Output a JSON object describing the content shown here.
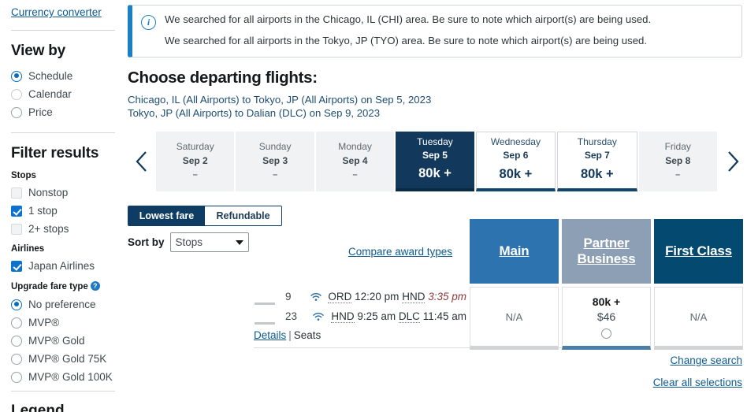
{
  "sidebar": {
    "currency_link": "Currency converter",
    "view_by": {
      "title": "View by",
      "options": [
        {
          "label": "Schedule",
          "selected": true
        },
        {
          "label": "Calendar",
          "selected": false
        },
        {
          "label": "Price",
          "selected": false
        }
      ]
    },
    "filter_results": {
      "title": "Filter results",
      "stops_title": "Stops",
      "stops": [
        {
          "label": "Nonstop",
          "checked": false
        },
        {
          "label": "1 stop",
          "checked": true
        },
        {
          "label": "2+ stops",
          "checked": false
        }
      ],
      "airlines_title": "Airlines",
      "airlines": [
        {
          "label": "Japan Airlines",
          "checked": true
        }
      ],
      "upgrade_title": "Upgrade fare type",
      "upgrade_help_icon": "question-mark-icon",
      "upgrade": [
        {
          "label": "No preference",
          "selected": true
        },
        {
          "label": "MVP®",
          "selected": false
        },
        {
          "label": "MVP® Gold",
          "selected": false
        },
        {
          "label": "MVP® Gold 75K",
          "selected": false
        },
        {
          "label": "MVP® Gold 100K",
          "selected": false
        }
      ]
    },
    "legend_title": "Legend"
  },
  "banner": {
    "icon": "info-icon",
    "messages": [
      "We searched for all airports in the Chicago, IL (CHI) area. Be sure to note which airport(s) are being used.",
      "We searched for all airports in the Tokyo, JP (TYO) area. Be sure to note which airport(s) are being used."
    ]
  },
  "header": {
    "title": "Choose departing flights:",
    "routes": [
      "Chicago, IL (All Airports) to Tokyo, JP (All Airports) on Sep 5, 2023",
      "Tokyo, JP (All Airports) to Dalian (DLC) on Sep 9, 2023"
    ]
  },
  "date_strip": {
    "prev_icon": "chevron-left-icon",
    "next_icon": "chevron-right-icon",
    "dates": [
      {
        "dow": "Saturday",
        "date": "Sep 2",
        "price": "–",
        "state": "unavailable"
      },
      {
        "dow": "Sunday",
        "date": "Sep 3",
        "price": "–",
        "state": "unavailable"
      },
      {
        "dow": "Monday",
        "date": "Sep 4",
        "price": "–",
        "state": "unavailable"
      },
      {
        "dow": "Tuesday",
        "date": "Sep 5",
        "price": "80k +",
        "state": "selected"
      },
      {
        "dow": "Wednesday",
        "date": "Sep 6",
        "price": "80k +",
        "state": "available"
      },
      {
        "dow": "Thursday",
        "date": "Sep 7",
        "price": "80k +",
        "state": "available"
      },
      {
        "dow": "Friday",
        "date": "Sep 8",
        "price": "–",
        "state": "unavailable"
      }
    ]
  },
  "controls": {
    "fare_toggle": [
      {
        "label": "Lowest fare",
        "active": true
      },
      {
        "label": "Refundable",
        "active": false
      }
    ],
    "sort_by_label": "Sort by",
    "sort_by_value": "Stops",
    "sort_by_icon": "chevron-down-icon",
    "compare_link": "Compare award types"
  },
  "fare_classes": [
    {
      "label": "Main",
      "color": "#2d73af"
    },
    {
      "label": "Partner Business",
      "color": "#8c9fb4"
    },
    {
      "label": "First Class",
      "color": "#044a70"
    }
  ],
  "itinerary": {
    "segments": [
      {
        "airline_logo": "japan-airlines-logo",
        "flight_number": "9",
        "wifi_icon": "wifi-icon",
        "origin": "ORD",
        "depart": "12:20 pm",
        "destination": "HND",
        "arrive": "3:35 pm",
        "arrive_next_day": true
      },
      {
        "airline_logo": "japan-airlines-logo",
        "flight_number": "23",
        "wifi_icon": "wifi-icon",
        "origin": "HND",
        "depart": "9:25 am",
        "destination": "DLC",
        "arrive": "11:45 am",
        "arrive_next_day": false
      }
    ],
    "details_link": "Details",
    "separator": "|",
    "seats_link": "Seats",
    "fares": [
      {
        "class": "Main",
        "value": "N/A",
        "miles": "",
        "cash": "",
        "selectable": false
      },
      {
        "class": "Partner Business",
        "value": "",
        "miles": "80k +",
        "cash": "$46",
        "selectable": true
      },
      {
        "class": "First Class",
        "value": "N/A",
        "miles": "",
        "cash": "",
        "selectable": false
      }
    ]
  },
  "footer_links": [
    {
      "label": "Change search"
    },
    {
      "label": "Clear all selections"
    }
  ]
}
